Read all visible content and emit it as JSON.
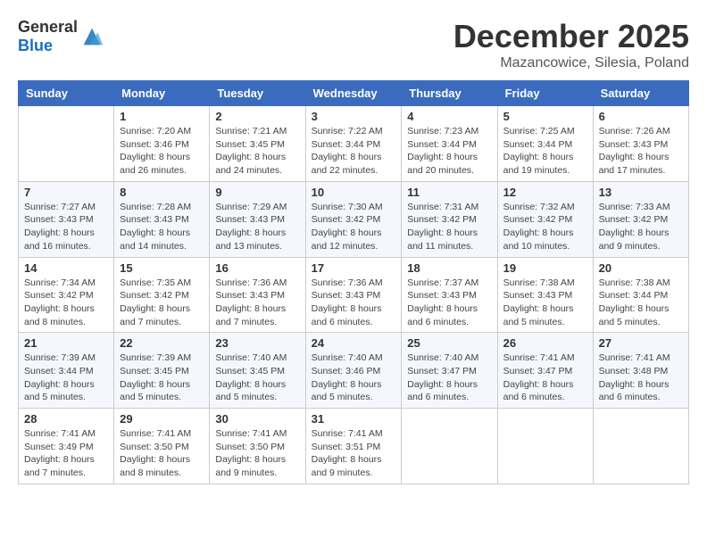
{
  "header": {
    "logo_general": "General",
    "logo_blue": "Blue",
    "month": "December 2025",
    "location": "Mazancowice, Silesia, Poland"
  },
  "weekdays": [
    "Sunday",
    "Monday",
    "Tuesday",
    "Wednesday",
    "Thursday",
    "Friday",
    "Saturday"
  ],
  "weeks": [
    [
      {
        "day": "",
        "info": ""
      },
      {
        "day": "1",
        "info": "Sunrise: 7:20 AM\nSunset: 3:46 PM\nDaylight: 8 hours\nand 26 minutes."
      },
      {
        "day": "2",
        "info": "Sunrise: 7:21 AM\nSunset: 3:45 PM\nDaylight: 8 hours\nand 24 minutes."
      },
      {
        "day": "3",
        "info": "Sunrise: 7:22 AM\nSunset: 3:44 PM\nDaylight: 8 hours\nand 22 minutes."
      },
      {
        "day": "4",
        "info": "Sunrise: 7:23 AM\nSunset: 3:44 PM\nDaylight: 8 hours\nand 20 minutes."
      },
      {
        "day": "5",
        "info": "Sunrise: 7:25 AM\nSunset: 3:44 PM\nDaylight: 8 hours\nand 19 minutes."
      },
      {
        "day": "6",
        "info": "Sunrise: 7:26 AM\nSunset: 3:43 PM\nDaylight: 8 hours\nand 17 minutes."
      }
    ],
    [
      {
        "day": "7",
        "info": "Sunrise: 7:27 AM\nSunset: 3:43 PM\nDaylight: 8 hours\nand 16 minutes."
      },
      {
        "day": "8",
        "info": "Sunrise: 7:28 AM\nSunset: 3:43 PM\nDaylight: 8 hours\nand 14 minutes."
      },
      {
        "day": "9",
        "info": "Sunrise: 7:29 AM\nSunset: 3:43 PM\nDaylight: 8 hours\nand 13 minutes."
      },
      {
        "day": "10",
        "info": "Sunrise: 7:30 AM\nSunset: 3:42 PM\nDaylight: 8 hours\nand 12 minutes."
      },
      {
        "day": "11",
        "info": "Sunrise: 7:31 AM\nSunset: 3:42 PM\nDaylight: 8 hours\nand 11 minutes."
      },
      {
        "day": "12",
        "info": "Sunrise: 7:32 AM\nSunset: 3:42 PM\nDaylight: 8 hours\nand 10 minutes."
      },
      {
        "day": "13",
        "info": "Sunrise: 7:33 AM\nSunset: 3:42 PM\nDaylight: 8 hours\nand 9 minutes."
      }
    ],
    [
      {
        "day": "14",
        "info": "Sunrise: 7:34 AM\nSunset: 3:42 PM\nDaylight: 8 hours\nand 8 minutes."
      },
      {
        "day": "15",
        "info": "Sunrise: 7:35 AM\nSunset: 3:42 PM\nDaylight: 8 hours\nand 7 minutes."
      },
      {
        "day": "16",
        "info": "Sunrise: 7:36 AM\nSunset: 3:43 PM\nDaylight: 8 hours\nand 7 minutes."
      },
      {
        "day": "17",
        "info": "Sunrise: 7:36 AM\nSunset: 3:43 PM\nDaylight: 8 hours\nand 6 minutes."
      },
      {
        "day": "18",
        "info": "Sunrise: 7:37 AM\nSunset: 3:43 PM\nDaylight: 8 hours\nand 6 minutes."
      },
      {
        "day": "19",
        "info": "Sunrise: 7:38 AM\nSunset: 3:43 PM\nDaylight: 8 hours\nand 5 minutes."
      },
      {
        "day": "20",
        "info": "Sunrise: 7:38 AM\nSunset: 3:44 PM\nDaylight: 8 hours\nand 5 minutes."
      }
    ],
    [
      {
        "day": "21",
        "info": "Sunrise: 7:39 AM\nSunset: 3:44 PM\nDaylight: 8 hours\nand 5 minutes."
      },
      {
        "day": "22",
        "info": "Sunrise: 7:39 AM\nSunset: 3:45 PM\nDaylight: 8 hours\nand 5 minutes."
      },
      {
        "day": "23",
        "info": "Sunrise: 7:40 AM\nSunset: 3:45 PM\nDaylight: 8 hours\nand 5 minutes."
      },
      {
        "day": "24",
        "info": "Sunrise: 7:40 AM\nSunset: 3:46 PM\nDaylight: 8 hours\nand 5 minutes."
      },
      {
        "day": "25",
        "info": "Sunrise: 7:40 AM\nSunset: 3:47 PM\nDaylight: 8 hours\nand 6 minutes."
      },
      {
        "day": "26",
        "info": "Sunrise: 7:41 AM\nSunset: 3:47 PM\nDaylight: 8 hours\nand 6 minutes."
      },
      {
        "day": "27",
        "info": "Sunrise: 7:41 AM\nSunset: 3:48 PM\nDaylight: 8 hours\nand 6 minutes."
      }
    ],
    [
      {
        "day": "28",
        "info": "Sunrise: 7:41 AM\nSunset: 3:49 PM\nDaylight: 8 hours\nand 7 minutes."
      },
      {
        "day": "29",
        "info": "Sunrise: 7:41 AM\nSunset: 3:50 PM\nDaylight: 8 hours\nand 8 minutes."
      },
      {
        "day": "30",
        "info": "Sunrise: 7:41 AM\nSunset: 3:50 PM\nDaylight: 8 hours\nand 9 minutes."
      },
      {
        "day": "31",
        "info": "Sunrise: 7:41 AM\nSunset: 3:51 PM\nDaylight: 8 hours\nand 9 minutes."
      },
      {
        "day": "",
        "info": ""
      },
      {
        "day": "",
        "info": ""
      },
      {
        "day": "",
        "info": ""
      }
    ]
  ]
}
